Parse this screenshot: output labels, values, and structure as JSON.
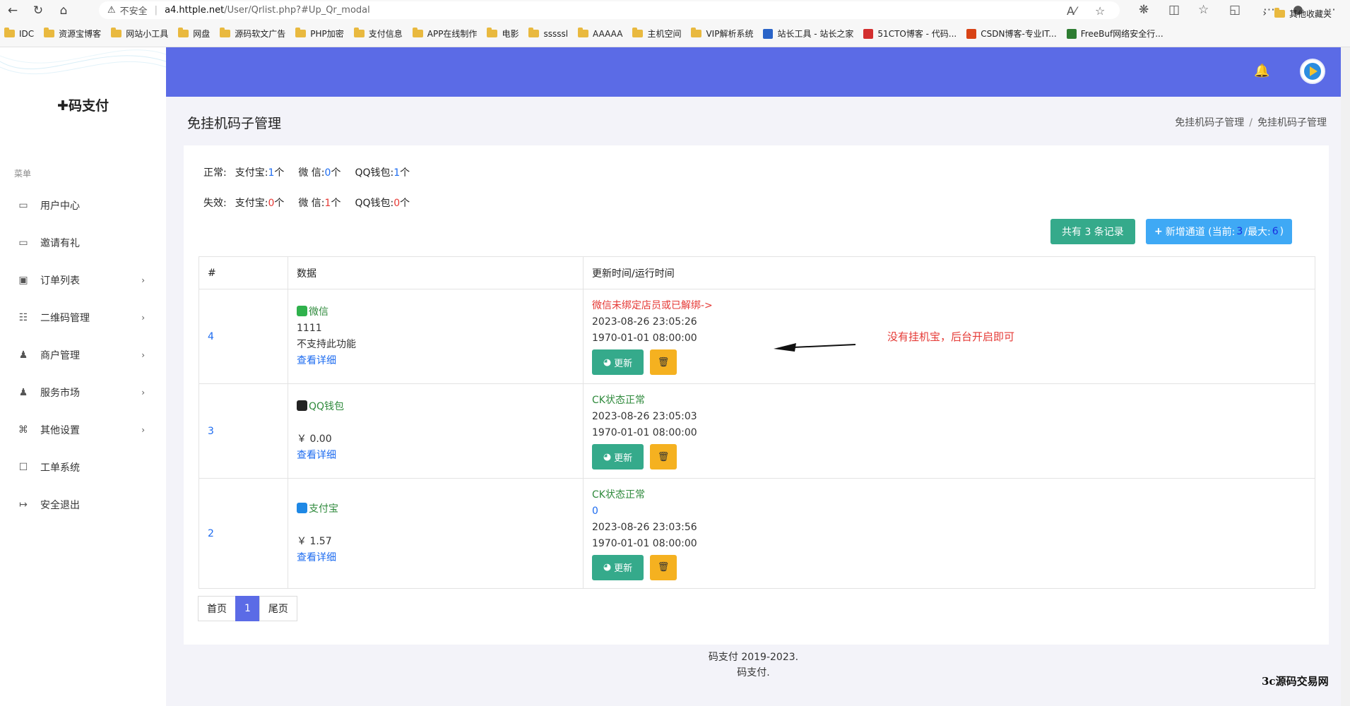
{
  "browser": {
    "insecure_label": "不安全",
    "url_host": "a4.httple.net",
    "url_path": "/User/Qrlist.php?#Up_Qr_modal",
    "bookmarks": [
      {
        "label": "IDC",
        "type": "folder"
      },
      {
        "label": "资源宝博客",
        "type": "folder"
      },
      {
        "label": "网站小工具",
        "type": "folder"
      },
      {
        "label": "网盘",
        "type": "folder"
      },
      {
        "label": "源码软文广告",
        "type": "folder"
      },
      {
        "label": "PHP加密",
        "type": "folder"
      },
      {
        "label": "支付信息",
        "type": "folder"
      },
      {
        "label": "APP在线制作",
        "type": "folder"
      },
      {
        "label": "电影",
        "type": "folder"
      },
      {
        "label": "sssssl",
        "type": "folder"
      },
      {
        "label": "AAAAA",
        "type": "folder"
      },
      {
        "label": "主机空间",
        "type": "folder"
      },
      {
        "label": "VIP解析系统",
        "type": "folder"
      },
      {
        "label": "站长工具 - 站长之家",
        "type": "site"
      },
      {
        "label": "51CTO博客 - 代码...",
        "type": "site"
      },
      {
        "label": "CSDN博客-专业IT...",
        "type": "site"
      },
      {
        "label": "FreeBuf网络安全行...",
        "type": "site"
      }
    ],
    "other_bookmarks": "其他收藏夹"
  },
  "sidebar": {
    "logo": "码支付",
    "menu_title": "菜单",
    "items": [
      {
        "label": "用户中心",
        "icon": "monitor-icon",
        "has_arrow": false
      },
      {
        "label": "邀请有礼",
        "icon": "monitor-icon",
        "has_arrow": false
      },
      {
        "label": "订单列表",
        "icon": "money-icon",
        "has_arrow": true
      },
      {
        "label": "二维码管理",
        "icon": "qrcode-icon",
        "has_arrow": true
      },
      {
        "label": "商户管理",
        "icon": "users-icon",
        "has_arrow": true
      },
      {
        "label": "服务市场",
        "icon": "users-icon",
        "has_arrow": true
      },
      {
        "label": "其他设置",
        "icon": "command-icon",
        "has_arrow": true
      },
      {
        "label": "工单系统",
        "icon": "ticket-icon",
        "has_arrow": false
      },
      {
        "label": "安全退出",
        "icon": "logout-icon",
        "has_arrow": false
      }
    ]
  },
  "page": {
    "title": "免挂机码子管理",
    "breadcrumb": [
      "免挂机码子管理",
      "免挂机码子管理"
    ]
  },
  "stats": {
    "normal_label": "正常:",
    "invalid_label": "失效:",
    "normal": [
      {
        "name": "支付宝:",
        "count": "1",
        "unit": "个"
      },
      {
        "name": "微 信:",
        "count": "0",
        "unit": "个"
      },
      {
        "name": "QQ钱包:",
        "count": "1",
        "unit": "个"
      }
    ],
    "invalid": [
      {
        "name": "支付宝:",
        "count": "0",
        "unit": "个"
      },
      {
        "name": "微 信:",
        "count": "1",
        "unit": "个"
      },
      {
        "name": "QQ钱包:",
        "count": "0",
        "unit": "个"
      }
    ]
  },
  "actions": {
    "record_count_text": "共有 3 条记录",
    "add_channel_prefix": "新增通道 (当前:",
    "add_channel_current": "3",
    "add_channel_mid": "/最大:",
    "add_channel_max": "6",
    "add_channel_suffix": ")"
  },
  "table": {
    "headers": [
      "#",
      "数据",
      "更新时间/运行时间"
    ],
    "rows": [
      {
        "id": "4",
        "channel": "微信",
        "channel_color": "#2f8a3c",
        "line2": "1111",
        "line3": "不支持此功能",
        "detail": "查看详细",
        "status": "微信未绑定店员或已解绑->",
        "status_color": "#e53935",
        "extra": "",
        "update_time": "2023-08-26 23:05:26",
        "run_time": "1970-01-01 08:00:00",
        "update_btn": "更新"
      },
      {
        "id": "3",
        "channel": "QQ钱包",
        "channel_color": "#2f8a3c",
        "line2": "",
        "line3": "￥ 0.00",
        "detail": "查看详细",
        "status": "CK状态正常",
        "status_color": "#2f8a3c",
        "extra": "",
        "update_time": "2023-08-26 23:05:03",
        "run_time": "1970-01-01 08:00:00",
        "update_btn": "更新"
      },
      {
        "id": "2",
        "channel": "支付宝",
        "channel_color": "#2f8a3c",
        "line2": "",
        "line3": "￥ 1.57",
        "detail": "查看详细",
        "status": "CK状态正常",
        "status_color": "#2f8a3c",
        "extra": "0",
        "update_time": "2023-08-26 23:03:56",
        "run_time": "1970-01-01 08:00:00",
        "update_btn": "更新"
      }
    ]
  },
  "annotation": "没有挂机宝，后台开启即可",
  "pagination": {
    "first": "首页",
    "current": "1",
    "last": "尾页"
  },
  "footer": {
    "line1": "码支付 2019-2023.",
    "line2": "码支付."
  },
  "watermark": "3c源码交易网",
  "colors": {
    "header": "#5b6be6",
    "success": "#35aa8b",
    "warning": "#f5b120",
    "info": "#3fa9f5",
    "danger": "#e53935"
  }
}
